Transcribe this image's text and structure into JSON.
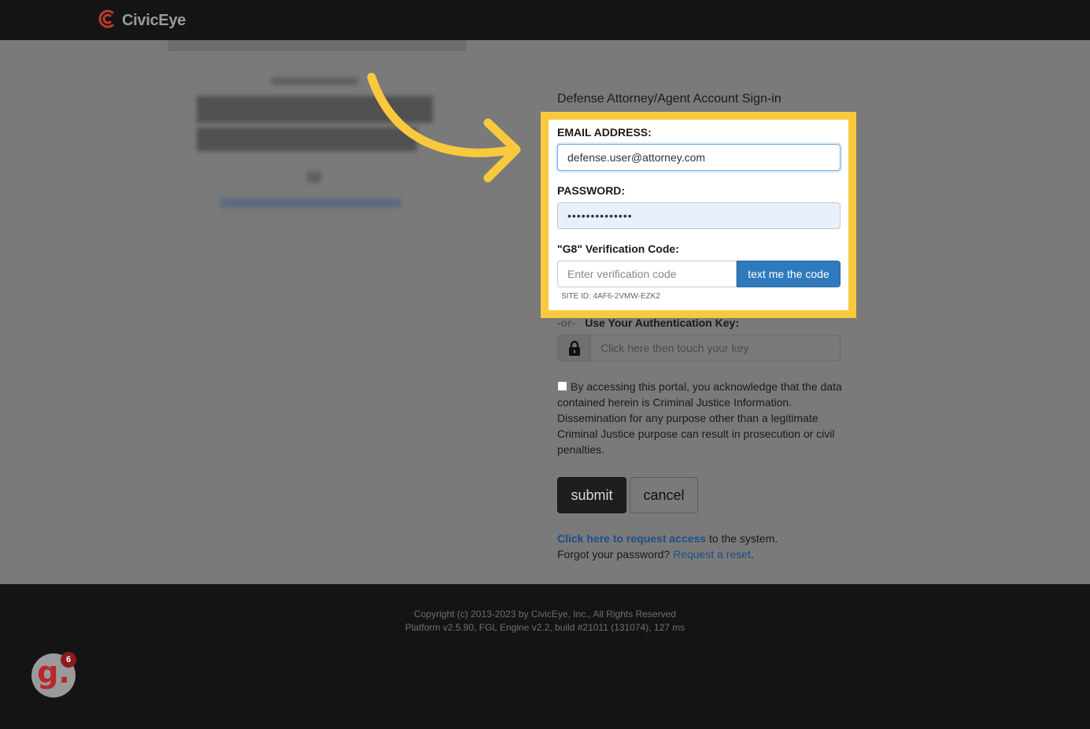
{
  "header": {
    "brand": "CivicEye",
    "logo_icon": "civiceye-logo-icon"
  },
  "form": {
    "title": "Defense Attorney/Agent Account Sign-in",
    "email_label": "EMAIL ADDRESS:",
    "email_value": "defense.user@attorney.com",
    "password_label": "PASSWORD:",
    "password_value": "••••••••••••••",
    "verification_label": "\"G8\" Verification Code:",
    "verification_placeholder": "Enter verification code",
    "text_code_button": "text me the code",
    "site_id": "SITE ID: 4AF6-2VMW-EZK2",
    "or_text": "-or-",
    "auth_key_label": "Use Your Authentication Key:",
    "auth_key_placeholder": "Click here then touch your key",
    "consent_text": "By accessing this portal, you acknowledge that the data contained herein is Criminal Justice Information. Dissemination for any purpose other than a legitimate Criminal Justice purpose can result in prosecution or civil penalties.",
    "submit_label": "submit",
    "cancel_label": "cancel"
  },
  "links": {
    "request_access_link": "Click here to request access",
    "request_access_suffix": " to the system.",
    "forgot_prefix": "Forgot your password? ",
    "reset_link": "Request a reset",
    "reset_suffix": "."
  },
  "footer": {
    "copyright": "Copyright (c) 2013-2023 by CivicEye, Inc., All Rights Reserved",
    "platform": "Platform v2.5.90, FGL Engine v2.2, build #21011 (131074), 127 ms"
  },
  "widget": {
    "letter": "g.",
    "count": "6"
  },
  "colors": {
    "highlight": "#f9c93d",
    "primary_button": "#2f79bd",
    "link": "#1d4f86",
    "brand_red": "#c0392b"
  }
}
